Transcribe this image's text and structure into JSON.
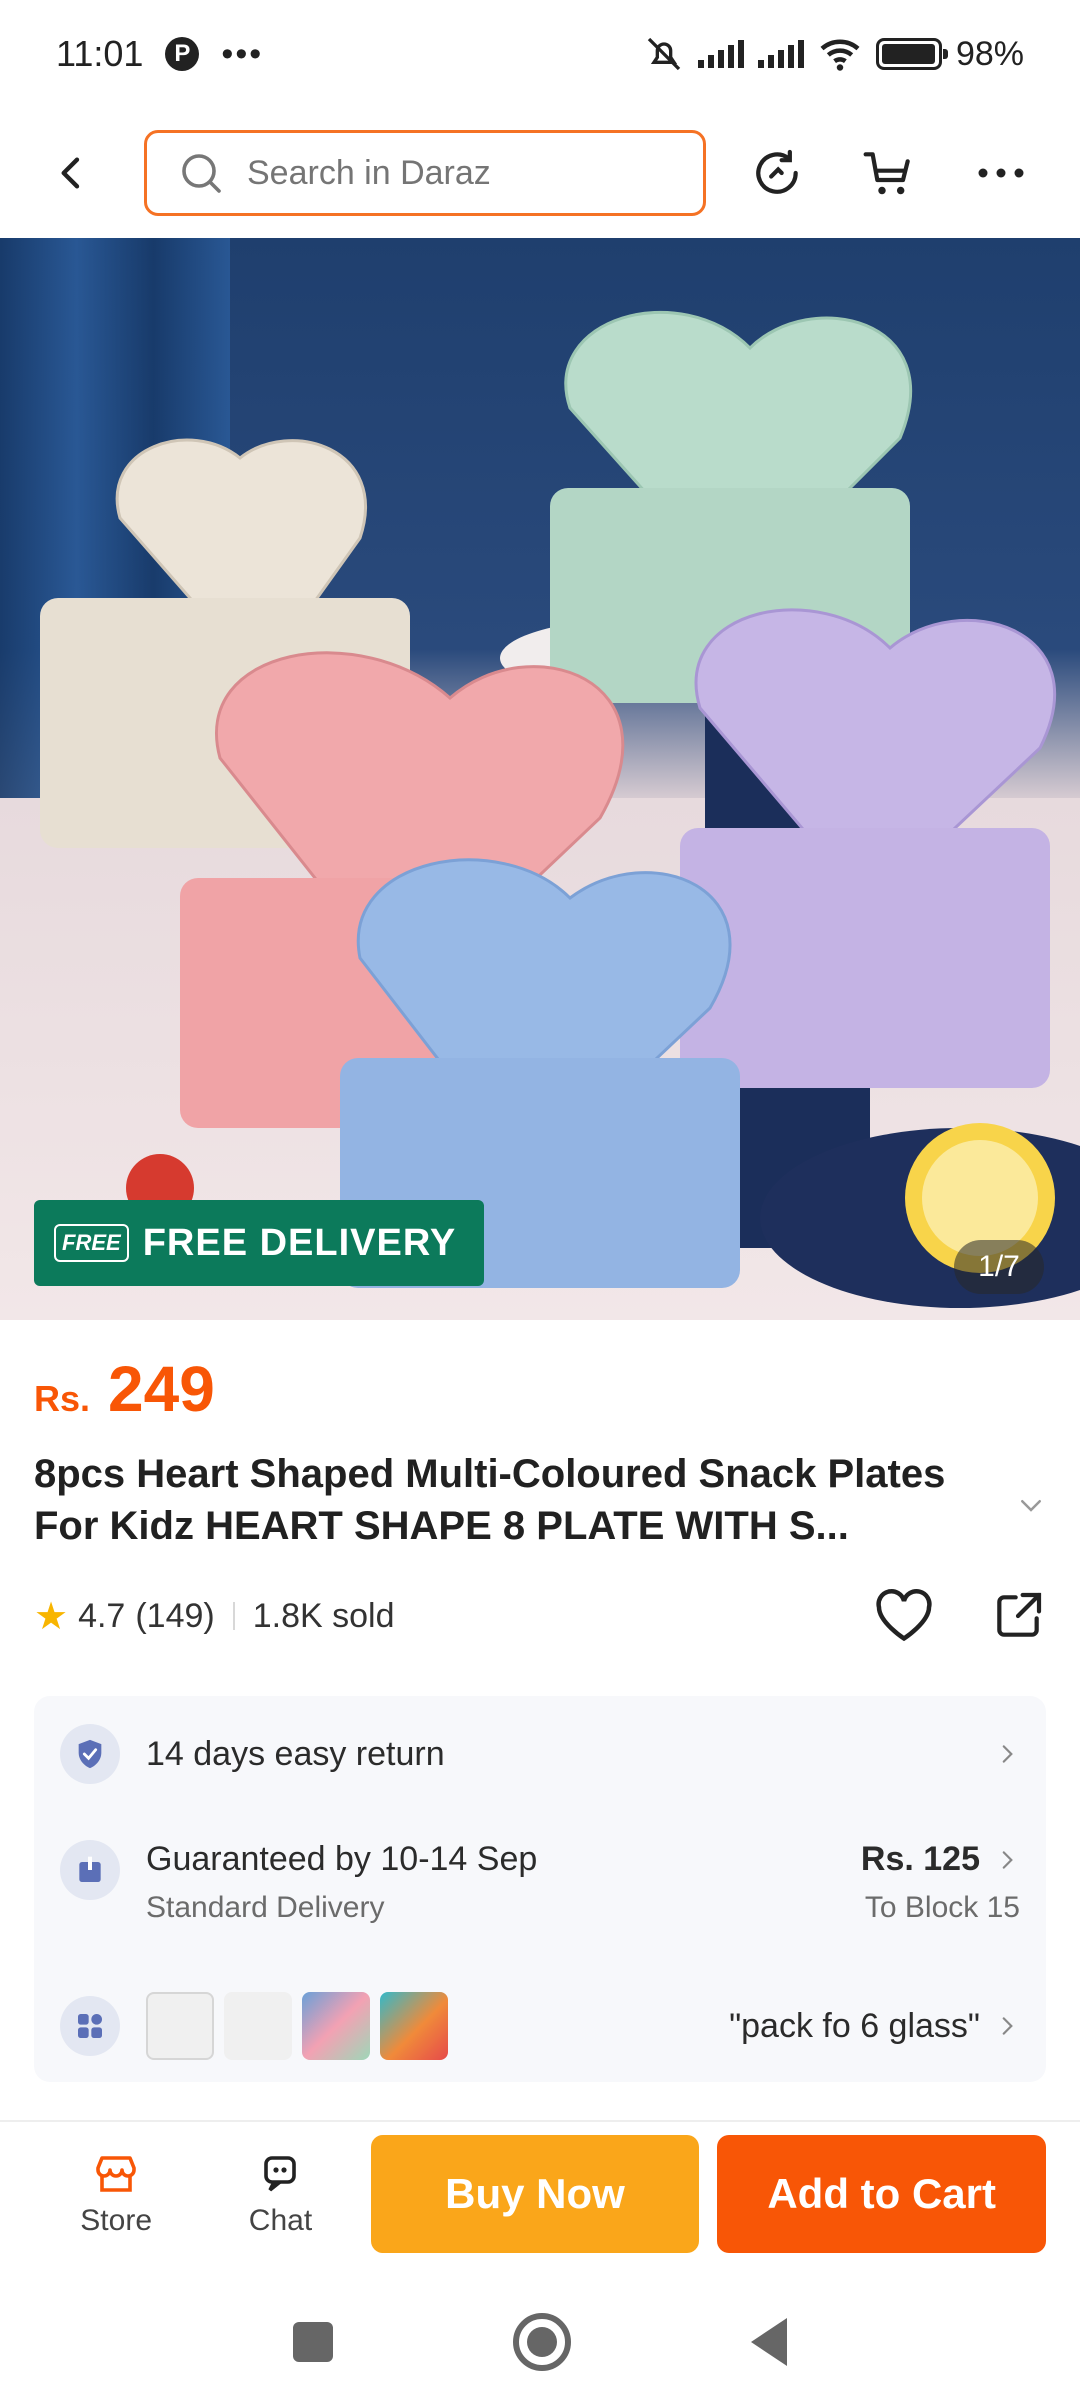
{
  "status_bar": {
    "time": "11:01",
    "battery": "98%",
    "battery_level": 0.98
  },
  "header": {
    "search_placeholder": "Search in Daraz"
  },
  "product": {
    "free_delivery": "FREE DELIVERY",
    "free_badge": "FREE",
    "image_counter": "1/7",
    "currency": "Rs.",
    "price": "249",
    "title": "8pcs Heart Shaped Multi-Coloured Snack Plates For Kidz HEART SHAPE 8 PLATE WITH S...",
    "rating": "4.7",
    "reviews": "(149)",
    "sold": "1.8K sold"
  },
  "info": {
    "return_text": "14 days easy return",
    "delivery_text": "Guaranteed by 10-14 Sep",
    "delivery_type": "Standard Delivery",
    "delivery_price": "Rs. 125",
    "delivery_location": "To Block 15",
    "variant_text": "\"pack fo 6 glass\""
  },
  "bottom_bar": {
    "store_label": "Store",
    "chat_label": "Chat",
    "buy_now": "Buy Now",
    "add_to_cart": "Add to Cart"
  },
  "colors": {
    "accent": "#f85606",
    "buy_now": "#faa61a",
    "free_delivery_bg": "#0c7a5b"
  }
}
